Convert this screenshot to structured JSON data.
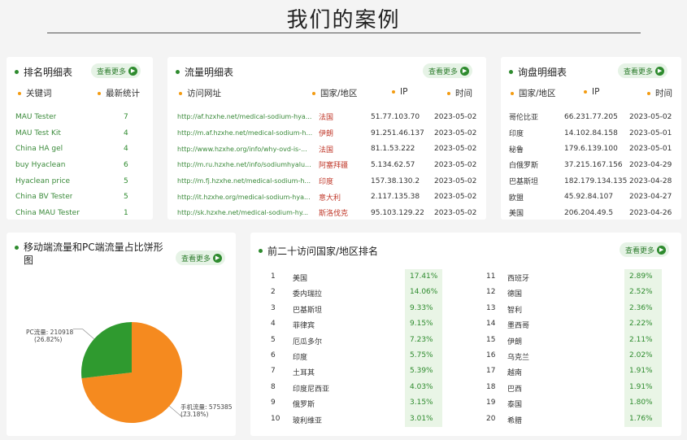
{
  "page_title": "我们的案例",
  "more_label": "查看更多",
  "keywords": {
    "title": "排名明细表",
    "col_keyword": "关键词",
    "col_stat": "最新统计",
    "rows": [
      {
        "k": "MAU Tester",
        "v": "7"
      },
      {
        "k": "MAU Test Kit",
        "v": "4"
      },
      {
        "k": "China HA gel",
        "v": "4"
      },
      {
        "k": "buy Hyaclean",
        "v": "6"
      },
      {
        "k": "Hyaclean price",
        "v": "5"
      },
      {
        "k": "China BV Tester",
        "v": "5"
      },
      {
        "k": "China MAU Tester",
        "v": "1"
      }
    ]
  },
  "traffic": {
    "title": "流量明细表",
    "col_url": "访问网址",
    "col_country": "国家/地区",
    "col_ip": "IP",
    "col_time": "时间",
    "rows": [
      {
        "url": "http://af.hzxhe.net/medical-sodium-hya...",
        "country": "法国",
        "ip": "51.77.103.70",
        "time": "2023-05-02"
      },
      {
        "url": "http://m.af.hzxhe.net/medical-sodium-h...",
        "country": "伊朗",
        "ip": "91.251.46.137",
        "time": "2023-05-02"
      },
      {
        "url": "http://www.hzxhe.org/info/why-ovd-is-...",
        "country": "法国",
        "ip": "81.1.53.222",
        "time": "2023-05-02"
      },
      {
        "url": "http://m.ru.hzxhe.net/info/sodiumhyalu...",
        "country": "阿塞拜疆",
        "ip": "5.134.62.57",
        "time": "2023-05-02"
      },
      {
        "url": "http://m.fj.hzxhe.net/medical-sodium-h...",
        "country": "印度",
        "ip": "157.38.130.2",
        "time": "2023-05-02"
      },
      {
        "url": "http://it.hzxhe.org/medical-sodium-hya...",
        "country": "意大利",
        "ip": "2.117.135.38",
        "time": "2023-05-02"
      },
      {
        "url": "http://sk.hzxhe.net/medical-sodium-hy...",
        "country": "斯洛伐克",
        "ip": "95.103.129.22",
        "time": "2023-05-02"
      }
    ]
  },
  "inquiry": {
    "title": "询盘明细表",
    "col_country": "国家/地区",
    "col_ip": "IP",
    "col_time": "时间",
    "rows": [
      {
        "country": "哥伦比亚",
        "ip": "66.231.77.205",
        "time": "2023-05-02"
      },
      {
        "country": "印度",
        "ip": "14.102.84.158",
        "time": "2023-05-01"
      },
      {
        "country": "秘鲁",
        "ip": "179.6.139.100",
        "time": "2023-05-01"
      },
      {
        "country": "白俄罗斯",
        "ip": "37.215.167.156",
        "time": "2023-04-29"
      },
      {
        "country": "巴基斯坦",
        "ip": "182.179.134.135",
        "time": "2023-04-28"
      },
      {
        "country": "欧盟",
        "ip": "45.92.84.107",
        "time": "2023-04-27"
      },
      {
        "country": "美国",
        "ip": "206.204.49.5",
        "time": "2023-04-26"
      }
    ]
  },
  "pie": {
    "title": "移动端流量和PC端流量占比饼形图",
    "pc_label": "PC流量: 210918",
    "pc_pct": "(26.82%)",
    "mobile_label": "手机流量: 575385",
    "mobile_pct": "(73.18%)",
    "pc_fraction": 0.2682,
    "pc_color": "#2f9a2f",
    "mobile_color": "#f58a1f"
  },
  "ranking": {
    "title": "前二十访问国家/地区排名",
    "left": [
      {
        "rank": "1",
        "country": "美国",
        "pct": "17.41%"
      },
      {
        "rank": "2",
        "country": "委内瑞拉",
        "pct": "14.06%"
      },
      {
        "rank": "3",
        "country": "巴基斯坦",
        "pct": "9.33%"
      },
      {
        "rank": "4",
        "country": "菲律宾",
        "pct": "9.15%"
      },
      {
        "rank": "5",
        "country": "厄瓜多尔",
        "pct": "7.23%"
      },
      {
        "rank": "6",
        "country": "印度",
        "pct": "5.75%"
      },
      {
        "rank": "7",
        "country": "土耳其",
        "pct": "5.39%"
      },
      {
        "rank": "8",
        "country": "印度尼西亚",
        "pct": "4.03%"
      },
      {
        "rank": "9",
        "country": "俄罗斯",
        "pct": "3.15%"
      },
      {
        "rank": "10",
        "country": "玻利维亚",
        "pct": "3.01%"
      }
    ],
    "right": [
      {
        "rank": "11",
        "country": "西班牙",
        "pct": "2.89%"
      },
      {
        "rank": "12",
        "country": "德国",
        "pct": "2.52%"
      },
      {
        "rank": "13",
        "country": "智利",
        "pct": "2.36%"
      },
      {
        "rank": "14",
        "country": "墨西哥",
        "pct": "2.22%"
      },
      {
        "rank": "15",
        "country": "伊朗",
        "pct": "2.11%"
      },
      {
        "rank": "16",
        "country": "乌克兰",
        "pct": "2.02%"
      },
      {
        "rank": "17",
        "country": "越南",
        "pct": "1.91%"
      },
      {
        "rank": "18",
        "country": "巴西",
        "pct": "1.91%"
      },
      {
        "rank": "19",
        "country": "泰国",
        "pct": "1.80%"
      },
      {
        "rank": "20",
        "country": "希腊",
        "pct": "1.76%"
      }
    ]
  }
}
